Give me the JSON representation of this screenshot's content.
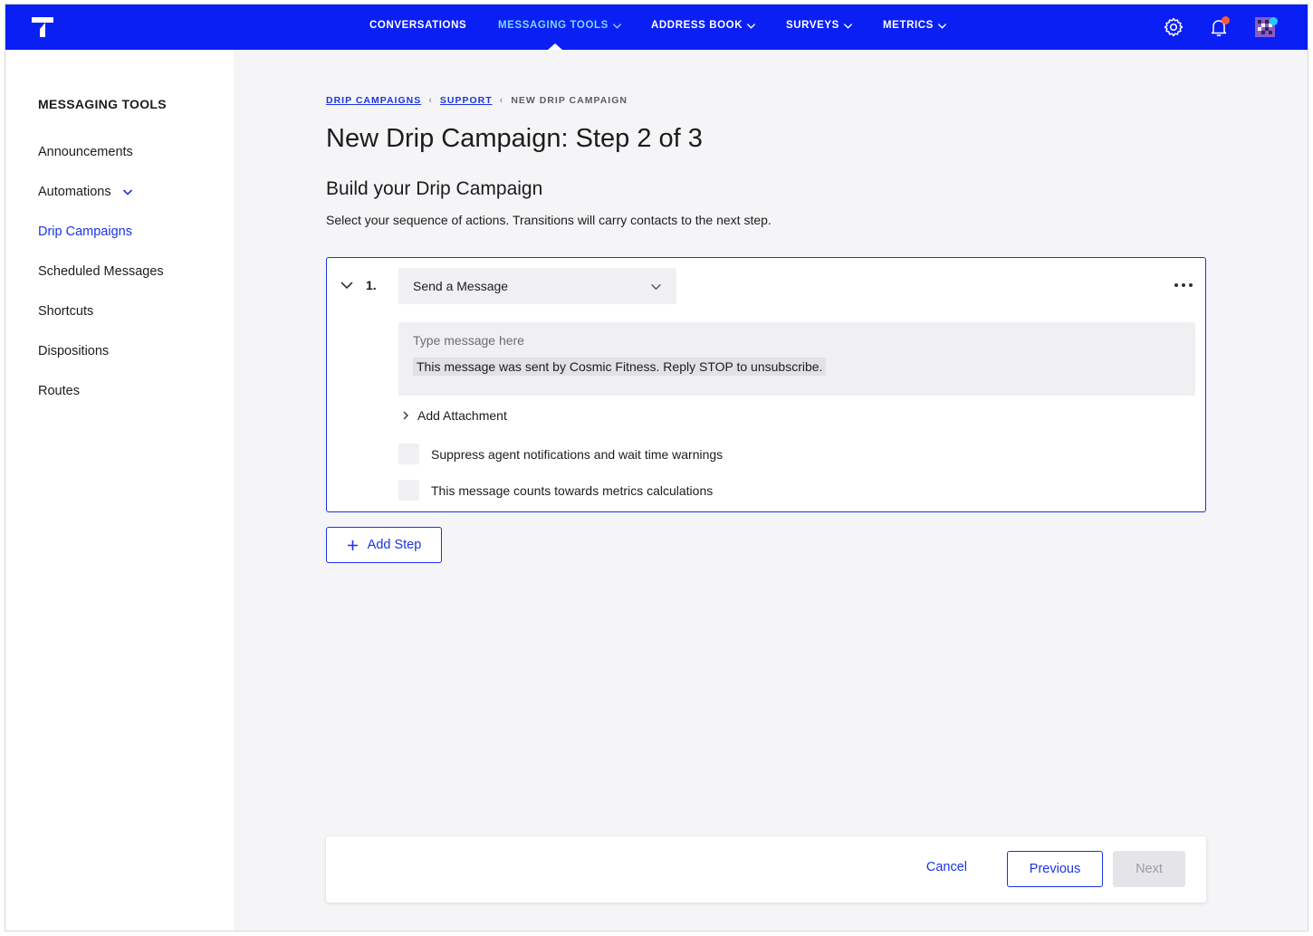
{
  "nav": {
    "items": [
      {
        "label": "CONVERSATIONS",
        "has_dropdown": false,
        "active": false
      },
      {
        "label": "MESSAGING TOOLS",
        "has_dropdown": true,
        "active": true
      },
      {
        "label": "ADDRESS BOOK",
        "has_dropdown": true,
        "active": false
      },
      {
        "label": "SURVEYS",
        "has_dropdown": true,
        "active": false
      },
      {
        "label": "METRICS",
        "has_dropdown": true,
        "active": false
      }
    ],
    "icons": [
      "settings-icon",
      "notification-bell-icon",
      "user-avatar"
    ],
    "colors": {
      "background": "#0a1ff4",
      "active_text": "#7fd6ff",
      "notification_badge": "#ff5a36",
      "avatar_badge": "#27c9ff"
    }
  },
  "sidebar": {
    "title": "MESSAGING TOOLS",
    "items": [
      {
        "label": "Announcements",
        "active": false
      },
      {
        "label": "Automations",
        "active": false,
        "expandable": true
      },
      {
        "label": "Drip Campaigns",
        "active": true
      },
      {
        "label": "Scheduled Messages",
        "active": false
      },
      {
        "label": "Shortcuts",
        "active": false
      },
      {
        "label": "Dispositions",
        "active": false
      },
      {
        "label": "Routes",
        "active": false
      }
    ]
  },
  "breadcrumb": {
    "items": [
      "DRIP CAMPAIGNS",
      "SUPPORT"
    ],
    "current": "NEW DRIP CAMPAIGN"
  },
  "page": {
    "title": "New Drip Campaign: Step 2 of 3",
    "section_title": "Build your Drip Campaign",
    "section_description": "Select your sequence of actions. Transitions will carry contacts to the next step."
  },
  "step": {
    "number": "1.",
    "action": "Send a Message",
    "message_placeholder": "Type message here",
    "message_text": "This message was sent by Cosmic Fitness. Reply STOP to unsubscribe.",
    "add_attachment_label": "Add Attachment",
    "options": [
      {
        "label": "Suppress agent notifications and wait time warnings",
        "checked": false
      },
      {
        "label": "This message counts towards metrics calculations",
        "checked": false
      }
    ]
  },
  "add_step_label": "Add Step",
  "footer": {
    "cancel_label": "Cancel",
    "previous_label": "Previous",
    "next_label": "Next",
    "next_disabled": true
  },
  "accent_color": "#1a33e6"
}
